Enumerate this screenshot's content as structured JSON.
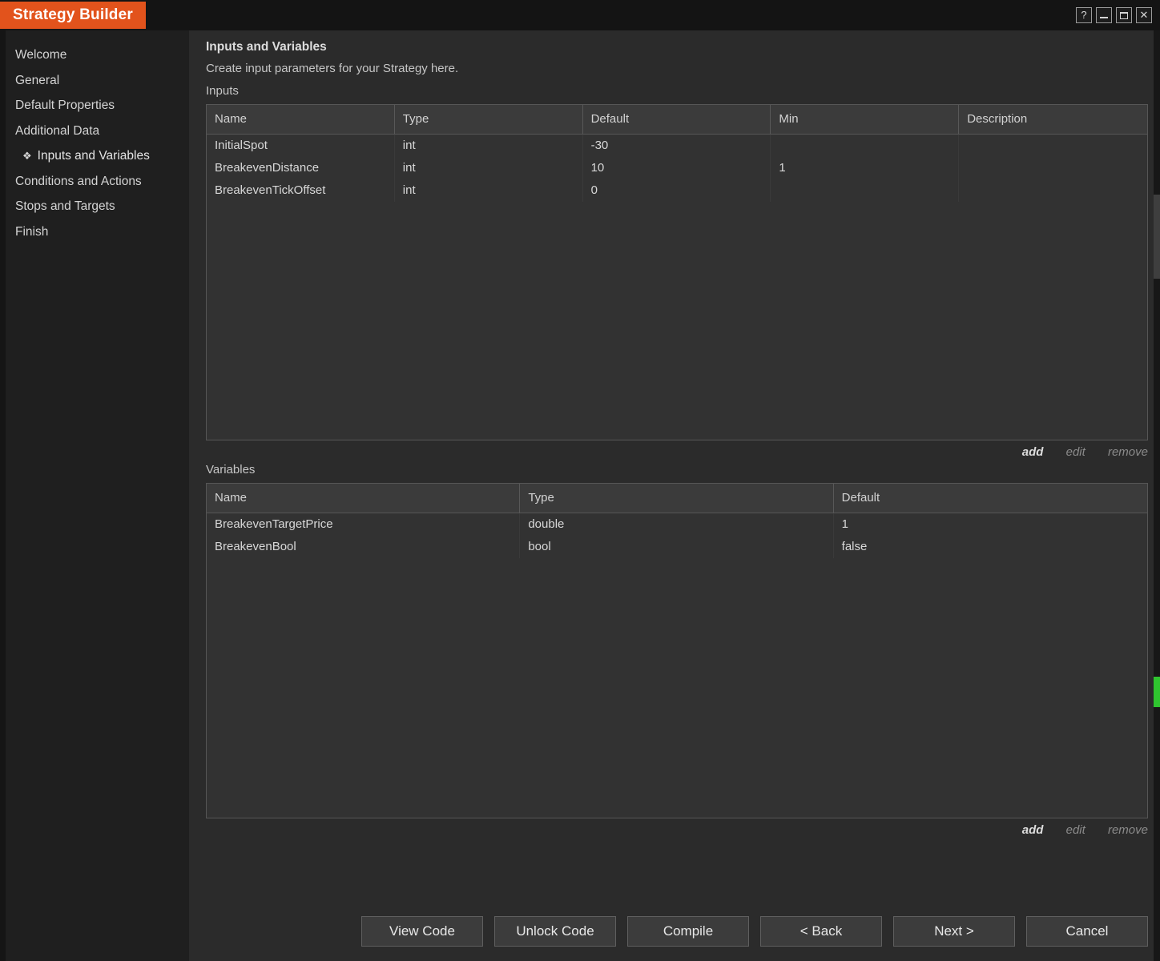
{
  "window": {
    "title": "Strategy Builder"
  },
  "icons": {
    "help": "?",
    "close": "✕",
    "active_item": "❖"
  },
  "sidebar": {
    "items": [
      {
        "label": "Welcome"
      },
      {
        "label": "General"
      },
      {
        "label": "Default Properties"
      },
      {
        "label": "Additional Data"
      },
      {
        "label": "Inputs and Variables",
        "active": true
      },
      {
        "label": "Conditions and Actions"
      },
      {
        "label": "Stops and Targets"
      },
      {
        "label": "Finish"
      }
    ]
  },
  "main": {
    "title": "Inputs and Variables",
    "subtitle": "Create input parameters for your Strategy here.",
    "inputs": {
      "label": "Inputs",
      "columns": [
        "Name",
        "Type",
        "Default",
        "Min",
        "Description"
      ],
      "rows": [
        {
          "name": "InitialSpot",
          "type": "int",
          "default": "-30",
          "min": "",
          "description": ""
        },
        {
          "name": "BreakevenDistance",
          "type": "int",
          "default": "10",
          "min": "1",
          "description": ""
        },
        {
          "name": "BreakevenTickOffset",
          "type": "int",
          "default": "0",
          "min": "",
          "description": ""
        }
      ],
      "actions": {
        "add": "add",
        "edit": "edit",
        "remove": "remove"
      }
    },
    "variables": {
      "label": "Variables",
      "columns": [
        "Name",
        "Type",
        "Default"
      ],
      "rows": [
        {
          "name": "BreakevenTargetPrice",
          "type": "double",
          "default": "1"
        },
        {
          "name": "BreakevenBool",
          "type": "bool",
          "default": "false"
        }
      ],
      "actions": {
        "add": "add",
        "edit": "edit",
        "remove": "remove"
      }
    },
    "buttons": [
      "View Code",
      "Unlock Code",
      "Compile",
      "< Back",
      "Next >",
      "Cancel"
    ]
  },
  "colors": {
    "accent_orange": "#e2531c",
    "scroll_marker_green": "#2fc52f"
  }
}
